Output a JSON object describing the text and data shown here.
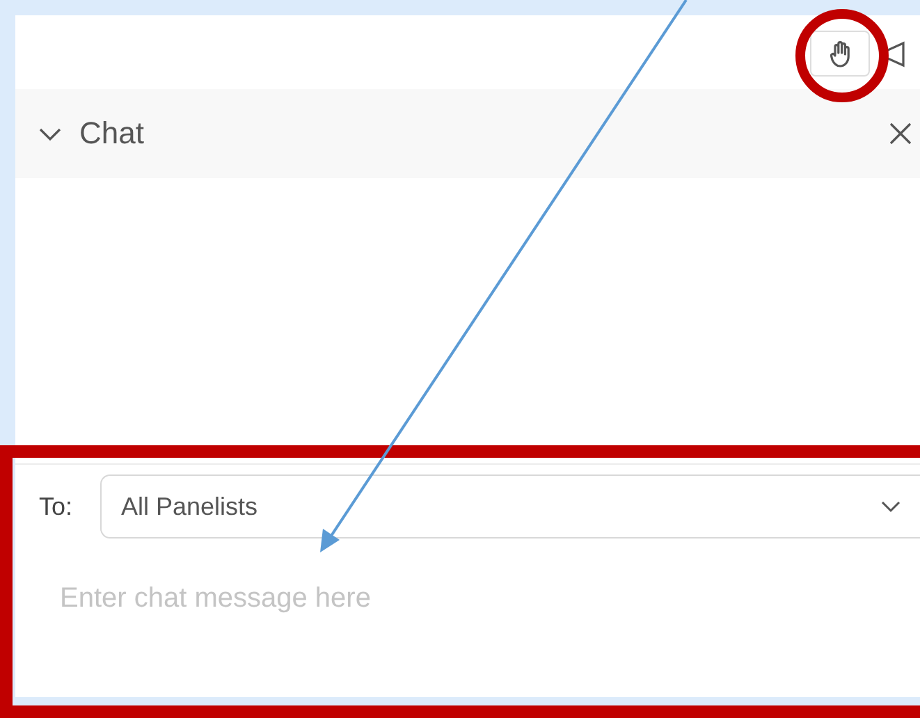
{
  "toolbar": {
    "buttons": [
      {
        "kind": "raise-hand"
      },
      {
        "kind": "megaphone"
      }
    ]
  },
  "chat": {
    "title": "Chat",
    "expanded": true,
    "recipient_label": "To:",
    "recipient": "All Panelists",
    "message": {
      "placeholder": "Enter chat message here"
    }
  },
  "annotations": [
    {
      "kind": "circle"
    },
    {
      "kind": "rectangle"
    },
    {
      "kind": "arrow"
    }
  ]
}
